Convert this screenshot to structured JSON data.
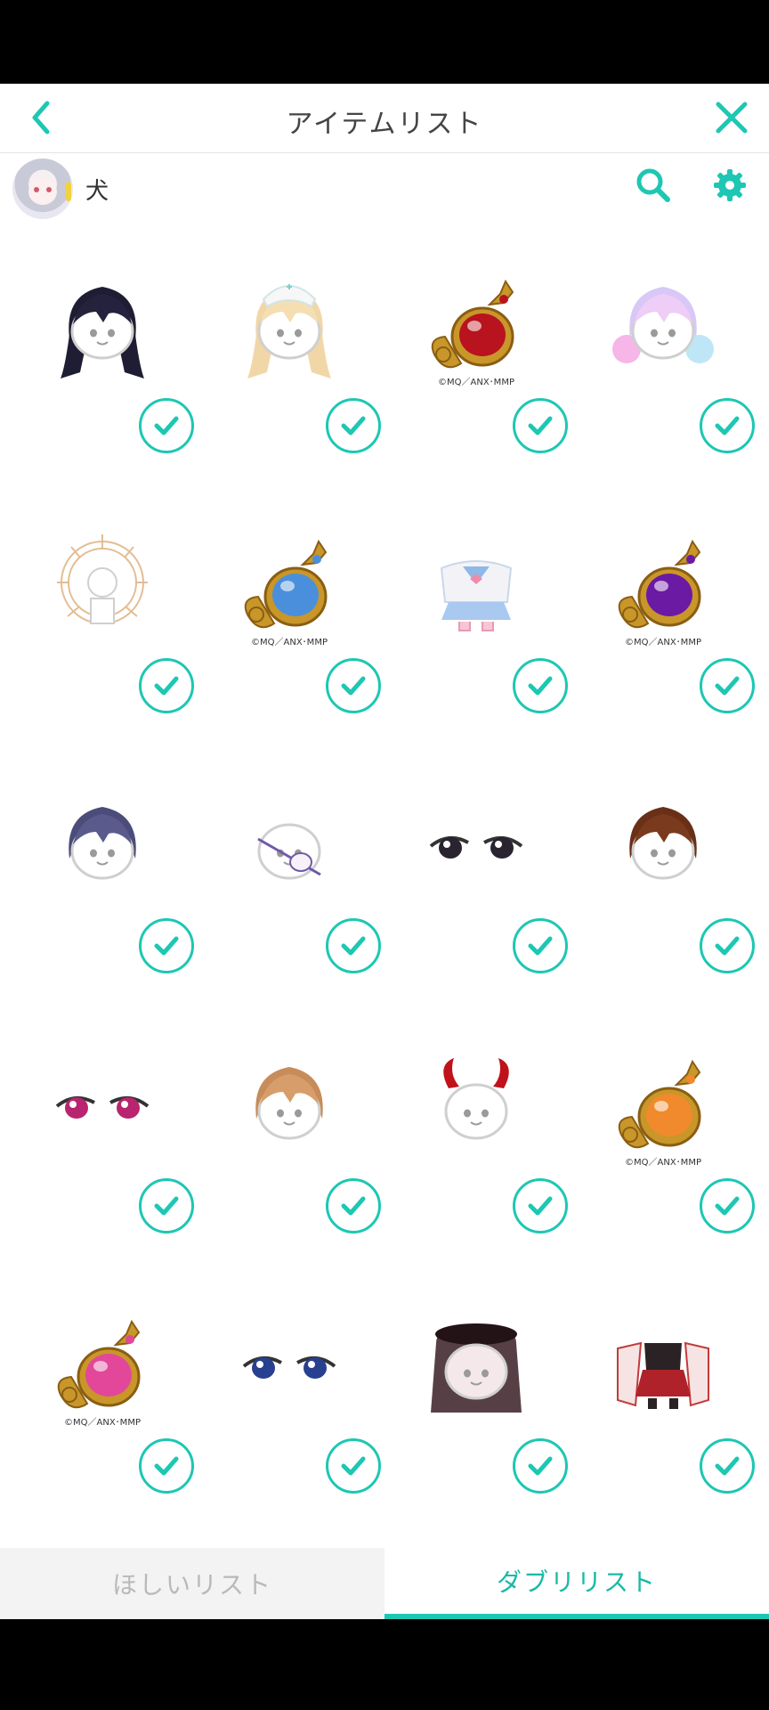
{
  "header": {
    "title": "アイテムリスト"
  },
  "user": {
    "name": "犬"
  },
  "colors": {
    "accent": "#1dc7b3",
    "tab_active_text": "#1ab9a6",
    "tab_inactive_text": "#b9b9b9"
  },
  "icons": {
    "back": "chevron-left-icon",
    "close": "close-icon",
    "search": "search-icon",
    "settings": "gear-icon",
    "check": "check-icon"
  },
  "items": [
    {
      "kind": "hair-long-dark",
      "checked": true,
      "copyright": ""
    },
    {
      "kind": "hair-blonde-nurse-cap",
      "checked": true,
      "copyright": ""
    },
    {
      "kind": "lamp-red",
      "checked": true,
      "copyright": "©MQ／ANX･MMP"
    },
    {
      "kind": "hair-pastel-twintails",
      "checked": true,
      "copyright": ""
    },
    {
      "kind": "halo-ornament",
      "checked": true,
      "copyright": ""
    },
    {
      "kind": "lamp-blue",
      "checked": true,
      "copyright": "©MQ／ANX･MMP"
    },
    {
      "kind": "sailor-outfit",
      "checked": true,
      "copyright": ""
    },
    {
      "kind": "lamp-purple",
      "checked": true,
      "copyright": "©MQ／ANX･MMP"
    },
    {
      "kind": "hair-short-navy",
      "checked": true,
      "copyright": ""
    },
    {
      "kind": "eyepatch",
      "checked": true,
      "copyright": ""
    },
    {
      "kind": "eyes-dark",
      "checked": true,
      "copyright": ""
    },
    {
      "kind": "hair-brown",
      "checked": true,
      "copyright": ""
    },
    {
      "kind": "eyes-pink",
      "checked": true,
      "copyright": ""
    },
    {
      "kind": "hair-light-brown",
      "checked": true,
      "copyright": ""
    },
    {
      "kind": "horns-red",
      "checked": true,
      "copyright": ""
    },
    {
      "kind": "lamp-orange",
      "checked": true,
      "copyright": "©MQ／ANX･MMP"
    },
    {
      "kind": "lamp-pink",
      "checked": true,
      "copyright": "©MQ／ANX･MMP"
    },
    {
      "kind": "eyes-blue",
      "checked": true,
      "copyright": ""
    },
    {
      "kind": "veil-black",
      "checked": true,
      "copyright": ""
    },
    {
      "kind": "shrine-outfit",
      "checked": true,
      "copyright": ""
    }
  ],
  "tabs": [
    {
      "label": "ほしいリスト",
      "active": false
    },
    {
      "label": "ダブリリスト",
      "active": true
    }
  ]
}
